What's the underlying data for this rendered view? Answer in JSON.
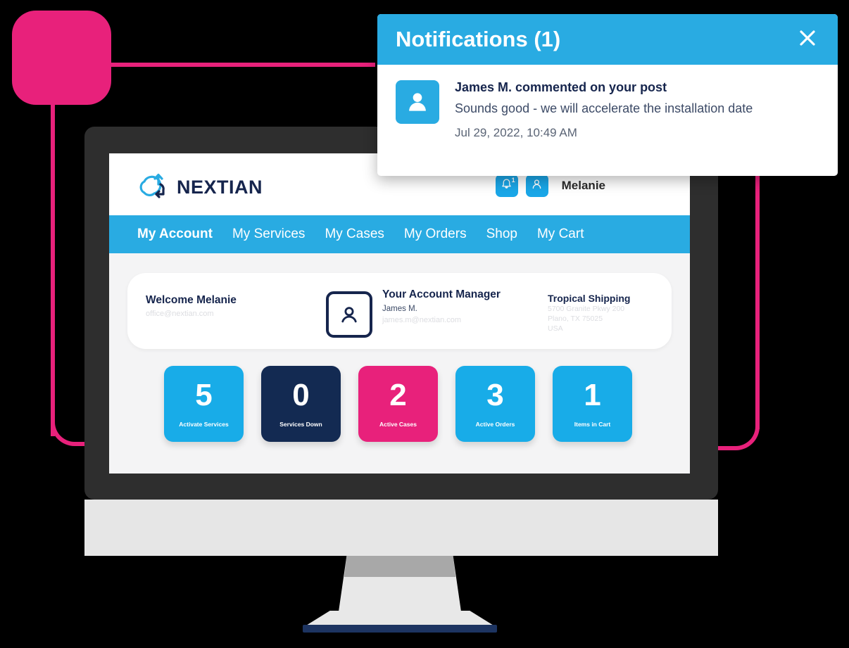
{
  "colors": {
    "cyan": "#29ABE2",
    "cyan_icon": "#1aa7e8",
    "pink": "#E8217B",
    "navy": "#16254d",
    "bezel": "#2e2e2e"
  },
  "header": {
    "logo_text": "NEXTIAN",
    "logo_icon": "cloud-arrow-icon",
    "bell_icon": "bell-icon",
    "bell_badge": "1",
    "account_icon": "user-icon",
    "user_name": "Melanie"
  },
  "nav": {
    "items": [
      {
        "label": "My Account",
        "active": true
      },
      {
        "label": "My Services",
        "active": false
      },
      {
        "label": "My Cases",
        "active": false
      },
      {
        "label": "My Orders",
        "active": false
      },
      {
        "label": "Shop",
        "active": false
      },
      {
        "label": "My Cart",
        "active": false
      }
    ]
  },
  "welcome_card": {
    "welcome_title": "Welcome Melanie",
    "welcome_email": "office@nextian.com",
    "manager_icon": "user-square-icon",
    "manager_title": "Your Account Manager",
    "manager_name": "James M.",
    "manager_email": "james.m@nextian.com",
    "company_name": "Tropical Shipping",
    "address_line1": "5700 Granite Pkwy 200",
    "address_line2": "Plano, TX 75025",
    "address_line3": "USA"
  },
  "tiles": [
    {
      "value": "5",
      "label": "Activate Services",
      "color": "#18ACE8"
    },
    {
      "value": "0",
      "label": "Services Down",
      "color": "#132A52"
    },
    {
      "value": "2",
      "label": "Active Cases",
      "color": "#E8217B"
    },
    {
      "value": "3",
      "label": "Active Orders",
      "color": "#18ACE8"
    },
    {
      "value": "1",
      "label": "Items in Cart",
      "color": "#18ACE8"
    }
  ],
  "notification_panel": {
    "title": "Notifications (1)",
    "close_icon": "close-icon",
    "avatar_icon": "user-icon",
    "item_heading": "James M. commented on your post",
    "item_message": "Sounds good - we will accelerate the installation date",
    "item_time": "Jul 29, 2022, 10:49 AM"
  }
}
